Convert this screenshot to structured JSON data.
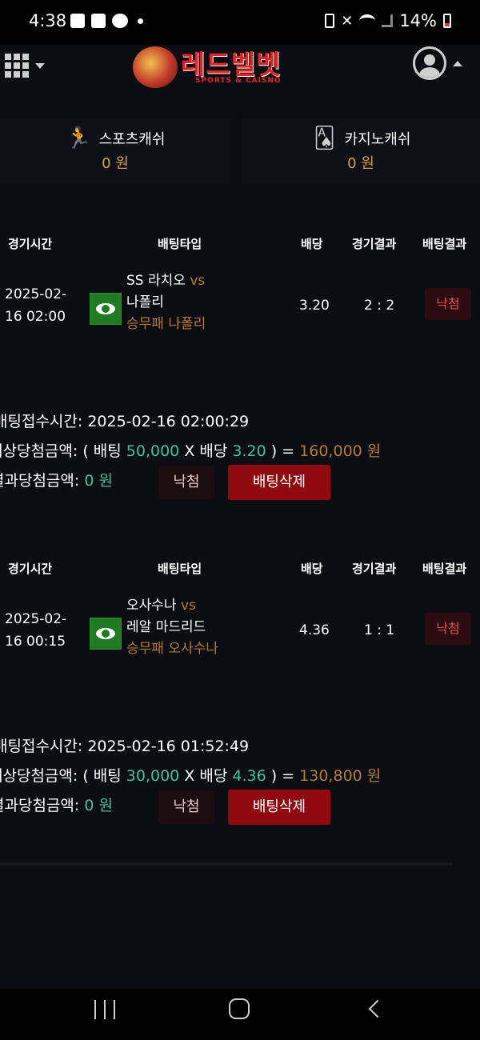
{
  "status_bar": {
    "time": "4:38",
    "battery": "14%",
    "left_icons": [
      "gallery-icon",
      "alert-icon",
      "cloud-icon",
      "dot-icon"
    ],
    "right_icons": [
      "saver-icon",
      "mute-icon",
      "wifi-icon",
      "signal-icon",
      "battery-icon"
    ]
  },
  "header": {
    "logo_title": "레드벨벳",
    "logo_subtitle": "SPORTS & CAISNO"
  },
  "cash": [
    {
      "label": "스포츠캐쉬",
      "value": "0 원",
      "icon": "runner-icon"
    },
    {
      "label": "카지노캐쉬",
      "value": "0 원",
      "icon": "cards-icon"
    }
  ],
  "columns": {
    "time": "경기시간",
    "type": "배팅타입",
    "odds": "배당",
    "score": "경기결과",
    "result": "배팅결과"
  },
  "bets": [
    {
      "date_line1": "2025-02-",
      "date_line2": "16 02:00",
      "home": "SS 라치오",
      "vs": "vs",
      "away": "나폴리",
      "pick": "승무패 나폴리",
      "odds": "3.20",
      "score": "2 : 2",
      "result": "낙첨",
      "accept_label": "배팅접수시간:",
      "accept_time": "2025-02-16 02:00:29",
      "expected_label": "예상당첨금액: ( 배팅",
      "stake": "50,000",
      "x_label": "X 배당",
      "expected_odds": "3.20",
      "close_label": ") =",
      "expected_amount": "160,000 원",
      "actual_label": "결과당첨금액:",
      "actual_amount": "0 원",
      "lose_button": "낙첨",
      "delete_button": "배팅삭제"
    },
    {
      "date_line1": "2025-02-",
      "date_line2": "16 00:15",
      "home": "오사수나",
      "vs": "vs",
      "away": "레알 마드리드",
      "pick": "승무패 오사수나",
      "odds": "4.36",
      "score": "1 : 1",
      "result": "낙첨",
      "accept_label": "배팅접수시간:",
      "accept_time": "2025-02-16 01:52:49",
      "expected_label": "예상당첨금액: ( 배팅",
      "stake": "30,000",
      "x_label": "X 배당",
      "expected_odds": "4.36",
      "close_label": ") =",
      "expected_amount": "130,800 원",
      "actual_label": "결과당첨금액:",
      "actual_amount": "0 원",
      "lose_button": "낙첨",
      "delete_button": "배팅삭제"
    }
  ],
  "nav_bar": [
    "recent-apps-icon",
    "home-icon",
    "back-icon"
  ]
}
